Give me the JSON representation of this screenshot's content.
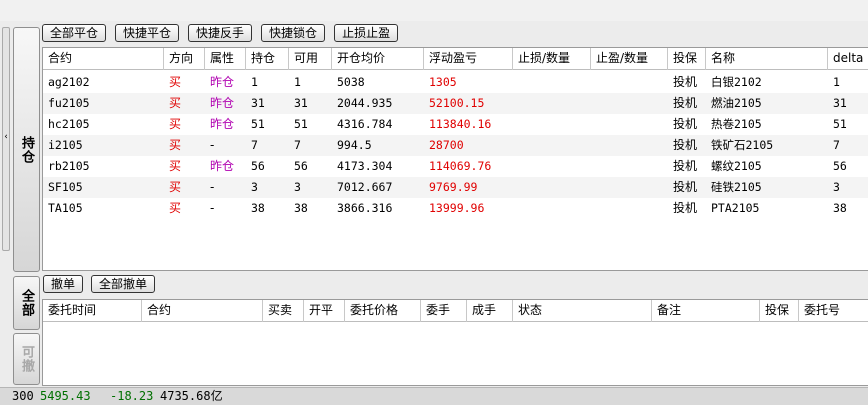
{
  "positions_toolbar": {
    "close_all": "全部平仓",
    "quick_close": "快捷平仓",
    "quick_reverse": "快捷反手",
    "quick_lock": "快捷锁仓",
    "stop_loss_profit": "止损止盈"
  },
  "tabs": {
    "collapse_arrow": "‹",
    "positions": "持仓",
    "all": "全部",
    "cancellable": "可撤"
  },
  "positions": {
    "columns": [
      "合约",
      "方向",
      "属性",
      "持仓",
      "可用",
      "开仓均价",
      "浮动盈亏",
      "止损/数量",
      "止盈/数量",
      "投保",
      "名称",
      "delta"
    ],
    "rows": [
      {
        "contract": "ag2102",
        "direction": "买",
        "attr": "昨仓",
        "hold": "1",
        "avail": "1",
        "avg_price": "5038",
        "pnl": "1305",
        "stop_loss": "",
        "take_profit": "",
        "hedge": "投机",
        "name": "白银2102",
        "delta": "1"
      },
      {
        "contract": "fu2105",
        "direction": "买",
        "attr": "昨仓",
        "hold": "31",
        "avail": "31",
        "avg_price": "2044.935",
        "pnl": "52100.15",
        "stop_loss": "",
        "take_profit": "",
        "hedge": "投机",
        "name": "燃油2105",
        "delta": "31"
      },
      {
        "contract": "hc2105",
        "direction": "买",
        "attr": "昨仓",
        "hold": "51",
        "avail": "51",
        "avg_price": "4316.784",
        "pnl": "113840.16",
        "stop_loss": "",
        "take_profit": "",
        "hedge": "投机",
        "name": "热卷2105",
        "delta": "51"
      },
      {
        "contract": "i2105",
        "direction": "买",
        "attr": "-",
        "hold": "7",
        "avail": "7",
        "avg_price": "994.5",
        "pnl": "28700",
        "stop_loss": "",
        "take_profit": "",
        "hedge": "投机",
        "name": "铁矿石2105",
        "delta": "7"
      },
      {
        "contract": "rb2105",
        "direction": "买",
        "attr": "昨仓",
        "hold": "56",
        "avail": "56",
        "avg_price": "4173.304",
        "pnl": "114069.76",
        "stop_loss": "",
        "take_profit": "",
        "hedge": "投机",
        "name": "螺纹2105",
        "delta": "56"
      },
      {
        "contract": "SF105",
        "direction": "买",
        "attr": "-",
        "hold": "3",
        "avail": "3",
        "avg_price": "7012.667",
        "pnl": "9769.99",
        "stop_loss": "",
        "take_profit": "",
        "hedge": "投机",
        "name": "硅铁2105",
        "delta": "3"
      },
      {
        "contract": "TA105",
        "direction": "买",
        "attr": "-",
        "hold": "38",
        "avail": "38",
        "avg_price": "3866.316",
        "pnl": "13999.96",
        "stop_loss": "",
        "take_profit": "",
        "hedge": "投机",
        "name": "PTA2105",
        "delta": "38"
      }
    ]
  },
  "orders_toolbar": {
    "cancel": "撤单",
    "cancel_all": "全部撤单"
  },
  "orders": {
    "columns": [
      "委托时间",
      "合约",
      "买卖",
      "开平",
      "委托价格",
      "委手",
      "成手",
      "状态",
      "备注",
      "投保",
      "委托号"
    ]
  },
  "status_bar": {
    "index_name": "300",
    "index_value": "5495.43",
    "index_change": "-18.23",
    "turnover": "4735.68亿"
  },
  "colors": {
    "buy": "#e00000",
    "attr_yesterday": "#b000b0",
    "pnl": "#e00000",
    "status_green": "#007000"
  },
  "icons": {
    "collapse_arrow": "chevron-left-icon"
  }
}
